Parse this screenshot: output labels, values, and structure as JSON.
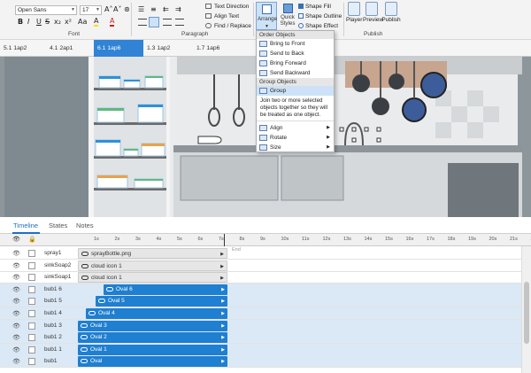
{
  "ribbon": {
    "font_name": "Open Sans",
    "font_size": "17",
    "fmt_row1": [
      "A˄",
      "A˅",
      "⊛"
    ],
    "fmt_row2": [
      "B",
      "I",
      "U",
      "S",
      "x₂",
      "x²",
      "Aa",
      "A",
      "A"
    ],
    "para_row1": [
      "☰",
      "≡",
      "⇇",
      "⇉"
    ],
    "group_font": "Font",
    "group_paragraph": "Paragraph",
    "text_direction": "Text Direction",
    "align_text": "Align Text",
    "find_replace": "Find / Replace",
    "arrange": "Arrange",
    "quick_styles": "Quick Styles",
    "shape_fill": "Shape Fill",
    "shape_outline": "Shape Outline",
    "shape_effect": "Shape Effect",
    "player": "Player",
    "preview": "Preview",
    "publish": "Publish",
    "group_publish": "Publish"
  },
  "tabs": [
    {
      "label": "5.1 1ap2"
    },
    {
      "label": "4.1 2ap1"
    },
    {
      "label": "6.1 1ap6"
    },
    {
      "label": "1.3 1ap2"
    },
    {
      "label": "1.7 1ap6"
    }
  ],
  "arrange_menu": {
    "section_order": "Order Objects",
    "bring_front": "Bring to Front",
    "send_back": "Send to Back",
    "bring_forward": "Bring Forward",
    "send_backward": "Send Backward",
    "section_group": "Group Objects",
    "group": "Group",
    "tooltip": "Join two or more selected objects together so they will be treated as one object.",
    "align": "Align",
    "rotate": "Rotate",
    "size": "Size"
  },
  "timeline": {
    "tab_timeline": "Timeline",
    "tab_states": "States",
    "tab_notes": "Notes",
    "ruler": [
      "1s",
      "2s",
      "3s",
      "4s",
      "5s",
      "6s",
      "7s",
      "8s",
      "9s",
      "10s",
      "11s",
      "12s",
      "13s",
      "14s",
      "15s",
      "16s",
      "17s",
      "18s",
      "19s",
      "20s",
      "21s",
      "2"
    ],
    "end_label": "End",
    "rows": [
      {
        "name": "spray1",
        "bar": "sprayBottle.png",
        "style": "grey",
        "selected": false
      },
      {
        "name": "sinkSoap2",
        "bar": "cloud icon 1",
        "style": "grey",
        "selected": false
      },
      {
        "name": "sinkSoap1",
        "bar": "cloud icon 1",
        "style": "grey",
        "selected": false
      },
      {
        "name": "bub1 6",
        "bar": "Oval 6",
        "style": "blue",
        "selected": true
      },
      {
        "name": "bub1 5",
        "bar": "Oval 5",
        "style": "blue",
        "selected": true
      },
      {
        "name": "bub1 4",
        "bar": "Oval 4",
        "style": "blue",
        "selected": true
      },
      {
        "name": "bub1 3",
        "bar": "Oval 3",
        "style": "blue",
        "selected": true
      },
      {
        "name": "bub1 2",
        "bar": "Oval 2",
        "style": "blue",
        "selected": true
      },
      {
        "name": "bub1 1",
        "bar": "Oval 1",
        "style": "blue",
        "selected": true
      },
      {
        "name": "bub1",
        "bar": "Oval",
        "style": "blue",
        "selected": true
      }
    ]
  },
  "colors": {
    "accent": "#1f7fd0",
    "tab_active": "#3083d5",
    "selected_row": "#dbe9f6"
  }
}
